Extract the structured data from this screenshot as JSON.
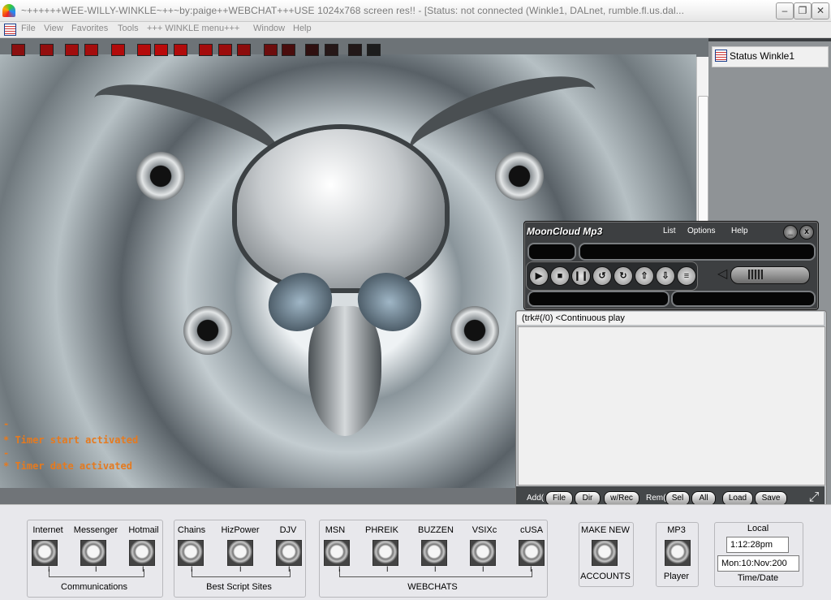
{
  "window": {
    "title": "~++++++WEE-WILLY-WINKLE~++~by:paige++WEBCHAT+++USE 1024x768 screen res!! - [Status: not connected (Winkle1, DALnet, rumble.fl.us.dal...",
    "minimize": "–",
    "restore": "❐",
    "close": "✕"
  },
  "menu": [
    "File",
    "View",
    "Favorites",
    "Tools",
    "+++ WINKLE menu+++",
    "Window",
    "Help"
  ],
  "swatch_colors": [
    "#8b0f0f",
    "#930e0e",
    "#a10d0d",
    "#a50d0d",
    "#b20b0b",
    "#b50b0b",
    "#ba0a0a",
    "#b10b0b",
    "#a50c0c",
    "#9c0c0c",
    "#8c0c0c",
    "#6d0d0d",
    "#4a0d0d",
    "#2f1010",
    "#261818",
    "#221818",
    "#1d1d1d"
  ],
  "log": [
    "-",
    "* Timer start activated",
    "-",
    "* Timer date activated"
  ],
  "switchbar": {
    "item": "Status Winkle1"
  },
  "mp3": {
    "title": "MoonCloud Mp3",
    "menu": [
      "List",
      "Options",
      "Help"
    ],
    "controls": [
      "play",
      "stop",
      "pause",
      "prev",
      "next",
      "up",
      "down",
      "list"
    ],
    "control_glyphs": [
      "▶",
      "■",
      "❙❙",
      "↺",
      "↻",
      "⇧",
      "⇩",
      "≡"
    ],
    "playlist_header": "(trk#(/0) <Continuous play",
    "add_label": "Add(",
    "rem_label": "Rem(",
    "buttons": {
      "file": "File",
      "dir": "Dir",
      "wrec": "w/Rec",
      "sel": "Sel",
      "all": "All",
      "load": "Load",
      "save": "Save"
    }
  },
  "toolbar": {
    "communications": {
      "items": [
        "Internet",
        "Messenger",
        "Hotmail"
      ],
      "caption": "Communications"
    },
    "scripts": {
      "items": [
        "Chains",
        "HizPower",
        "DJV"
      ],
      "caption": "Best Script Sites"
    },
    "webchats": {
      "items": [
        "MSN",
        "PHREIK",
        "BUZZEN",
        "VSIXc",
        "cUSA"
      ],
      "caption": "WEBCHATS"
    },
    "make_new": {
      "top": "MAKE NEW",
      "bottom": "ACCOUNTS"
    },
    "mp3": {
      "top": "MP3",
      "bottom": "Player"
    },
    "time": {
      "header": "Local",
      "time": "1:12:28pm",
      "date": "Mon:10:Nov:200",
      "caption": "Time/Date"
    },
    "connector_mark": "I"
  }
}
